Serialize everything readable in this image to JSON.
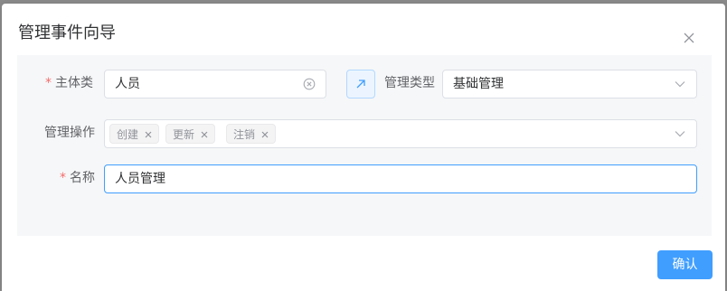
{
  "dialog": {
    "title": "管理事件向导",
    "confirm_label": "确认"
  },
  "form": {
    "subject_label": "主体类",
    "subject_value": "人员",
    "manage_type_label": "管理类型",
    "manage_type_value": "基础管理",
    "operations_label": "管理操作",
    "operations_tags": [
      "创建",
      "更新",
      "注销"
    ],
    "name_label": "名称",
    "name_value": "人员管理",
    "required_mark": "*"
  },
  "colors": {
    "primary": "#409eff",
    "required": "#f56c6c",
    "panel_bg": "#f6f7f8"
  },
  "icons": {
    "close": "close-icon",
    "clear": "circle-x-icon",
    "jump": "arrow-up-right-icon",
    "dropdown": "chevron-down-icon",
    "tag_remove": "close-icon"
  }
}
